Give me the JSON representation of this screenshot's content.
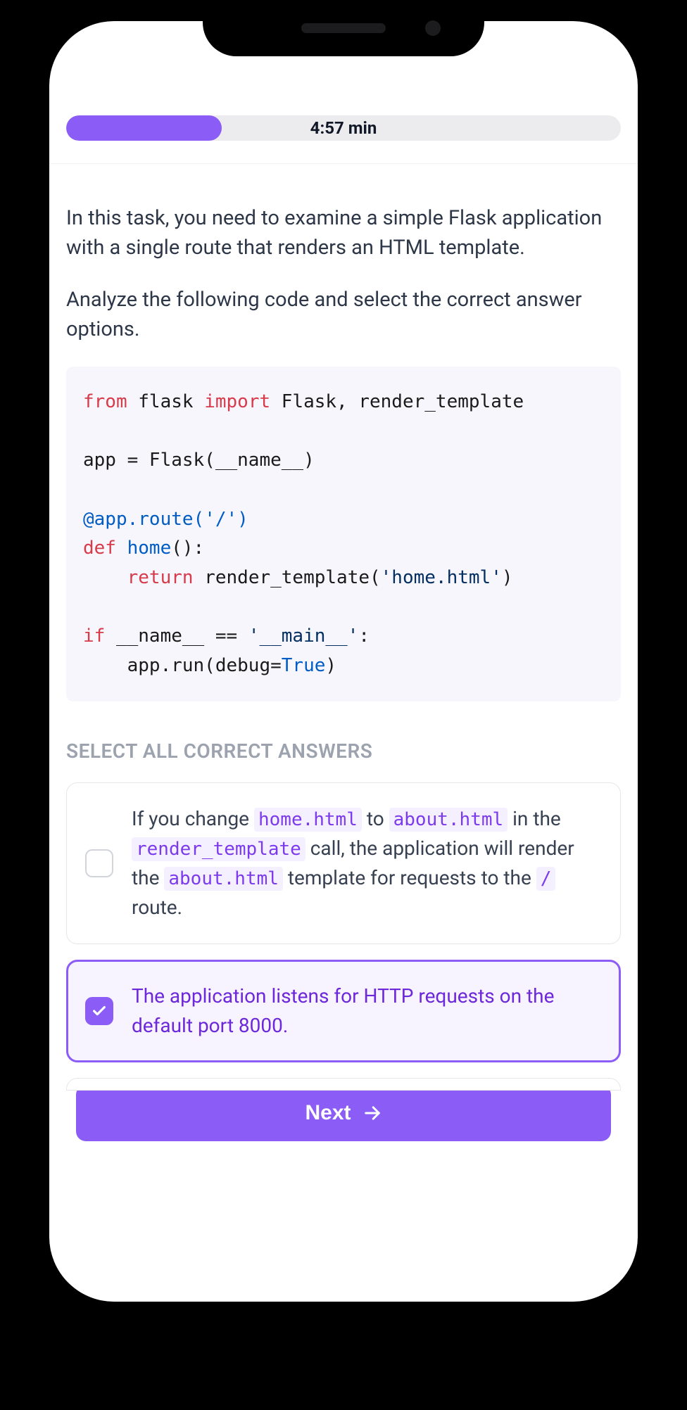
{
  "timer": {
    "label": "4:57 min",
    "progress_percent": 28
  },
  "question": {
    "para1": "In this task, you need to examine a simple Flask application with a single route that renders an HTML template.",
    "para2": "Analyze the following code and select the correct answer options."
  },
  "code": {
    "tok_from": "from",
    "tok_flask": " flask ",
    "tok_import": "import",
    "tok_imports": " Flask, render_template",
    "line_blank": "",
    "line_app": "app = Flask(__name__)",
    "tok_decorator": "@app.route",
    "tok_route_args": "('/')",
    "tok_def": "def",
    "tok_home": " home",
    "tok_home_paren": "():",
    "tok_return": "    return",
    "tok_render": " render_template(",
    "tok_homehtml": "'home.html'",
    "tok_close": ")",
    "tok_if": "if",
    "tok_name": " __name__ == ",
    "tok_main": "'__main__'",
    "tok_colon": ":",
    "tok_run": "    app.run(debug=",
    "tok_true": "True",
    "tok_run_close": ")"
  },
  "answers_label": "SELECT ALL CORRECT ANSWERS",
  "options": [
    {
      "selected": false,
      "parts": [
        {
          "t": "If you change ",
          "c": false
        },
        {
          "t": "home.html",
          "c": true
        },
        {
          "t": " to ",
          "c": false
        },
        {
          "t": "about.html",
          "c": true
        },
        {
          "t": " in the ",
          "c": false
        },
        {
          "t": "render_template",
          "c": true
        },
        {
          "t": " call, the application will render the ",
          "c": false
        },
        {
          "t": "about.html",
          "c": true
        },
        {
          "t": " template for requests to the ",
          "c": false
        },
        {
          "t": "/",
          "c": true
        },
        {
          "t": " route.",
          "c": false
        }
      ]
    },
    {
      "selected": true,
      "parts": [
        {
          "t": "The application listens for HTTP requests on the default port 8000.",
          "c": false
        }
      ]
    }
  ],
  "next_button": "Next"
}
